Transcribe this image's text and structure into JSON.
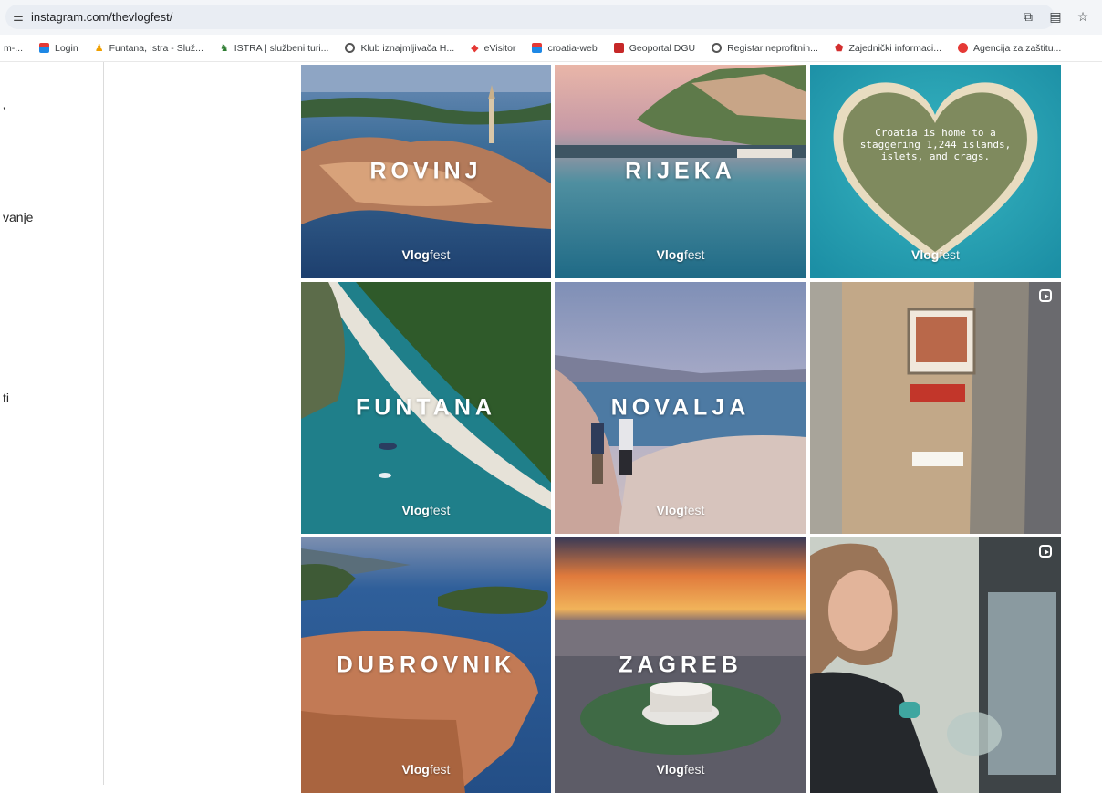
{
  "browser": {
    "url": "instagram.com/thevlogfest/",
    "bookmarks": [
      {
        "label": "m-...",
        "icon": "none"
      },
      {
        "label": "Login",
        "icon": "flag-icon"
      },
      {
        "label": "Funtana, Istra - Služ...",
        "icon": "people-icon"
      },
      {
        "label": "ISTRA | službeni turi...",
        "icon": "dino-icon"
      },
      {
        "label": "Klub iznajmljivača H...",
        "icon": "globe-icon"
      },
      {
        "label": "eVisitor",
        "icon": "diamond-icon"
      },
      {
        "label": "croatia-web",
        "icon": "flag-icon"
      },
      {
        "label": "Geoportal DGU",
        "icon": "geoportal-icon"
      },
      {
        "label": "Registar neprofitnih...",
        "icon": "globe-icon"
      },
      {
        "label": "Zajednički informaci...",
        "icon": "shield-icon"
      },
      {
        "label": "Agencija za zaštitu...",
        "icon": "swirl-icon"
      }
    ]
  },
  "sidebar": {
    "items": [
      {
        "label": "’"
      },
      {
        "label": "vanje"
      },
      {
        "label": "ti"
      }
    ]
  },
  "brand": {
    "bold": "Vlog",
    "light": "fest"
  },
  "posts": [
    {
      "title": "ROVINJ",
      "reel": false
    },
    {
      "title": "RIJEKA",
      "reel": false
    },
    {
      "title": "",
      "overlay": "Croatia is home to a staggering 1,244 islands, islets, and crags.",
      "reel": false
    },
    {
      "title": "FUNTANA",
      "reel": false
    },
    {
      "title": "NOVALJA",
      "reel": false
    },
    {
      "title": "",
      "reel": true
    },
    {
      "title": "DUBROVNIK",
      "reel": false
    },
    {
      "title": "ZAGREB",
      "reel": false
    },
    {
      "title": "",
      "reel": true
    }
  ]
}
